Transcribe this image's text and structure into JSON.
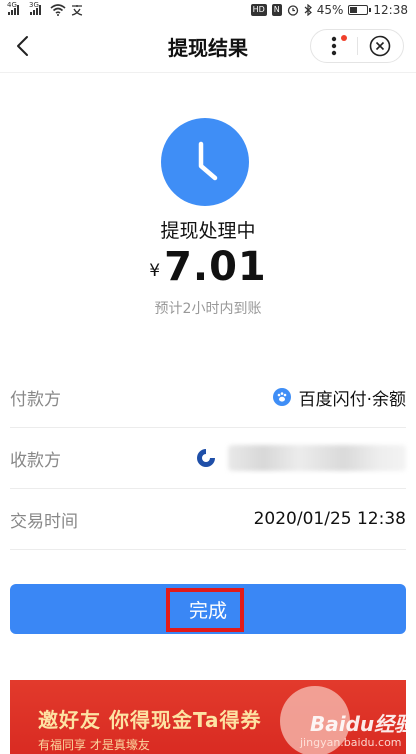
{
  "status_bar": {
    "sim1": "4G",
    "sim2": "3G",
    "nfc_badge": "HD",
    "n_badge": "N",
    "battery": "45%",
    "battery_level": 0.45,
    "time": "12:38"
  },
  "nav": {
    "title": "提现结果",
    "icons": [
      "back-icon",
      "more-icon",
      "close-icon"
    ]
  },
  "result": {
    "status": "提现处理中",
    "currency": "¥",
    "amount": "7.01",
    "eta": "预计2小时内到账"
  },
  "details": [
    {
      "label": "付款方",
      "value": "百度闪付·余额"
    },
    {
      "label": "收款方",
      "value": ""
    },
    {
      "label": "交易时间",
      "value": "2020/01/25 12:38"
    }
  ],
  "done_button": {
    "label": "完成"
  },
  "banner": {
    "headline": "邀好友  你得现金Ta得券",
    "subline": "有福同享  才是真壕友"
  },
  "watermark": {
    "logo": "Baidu经验",
    "url": "jingyan.baidu.com"
  },
  "colors": {
    "accent": "#3a87f5",
    "clock": "#3f8ef6",
    "highlight": "#e21a1a",
    "banner": "#d92b22"
  }
}
